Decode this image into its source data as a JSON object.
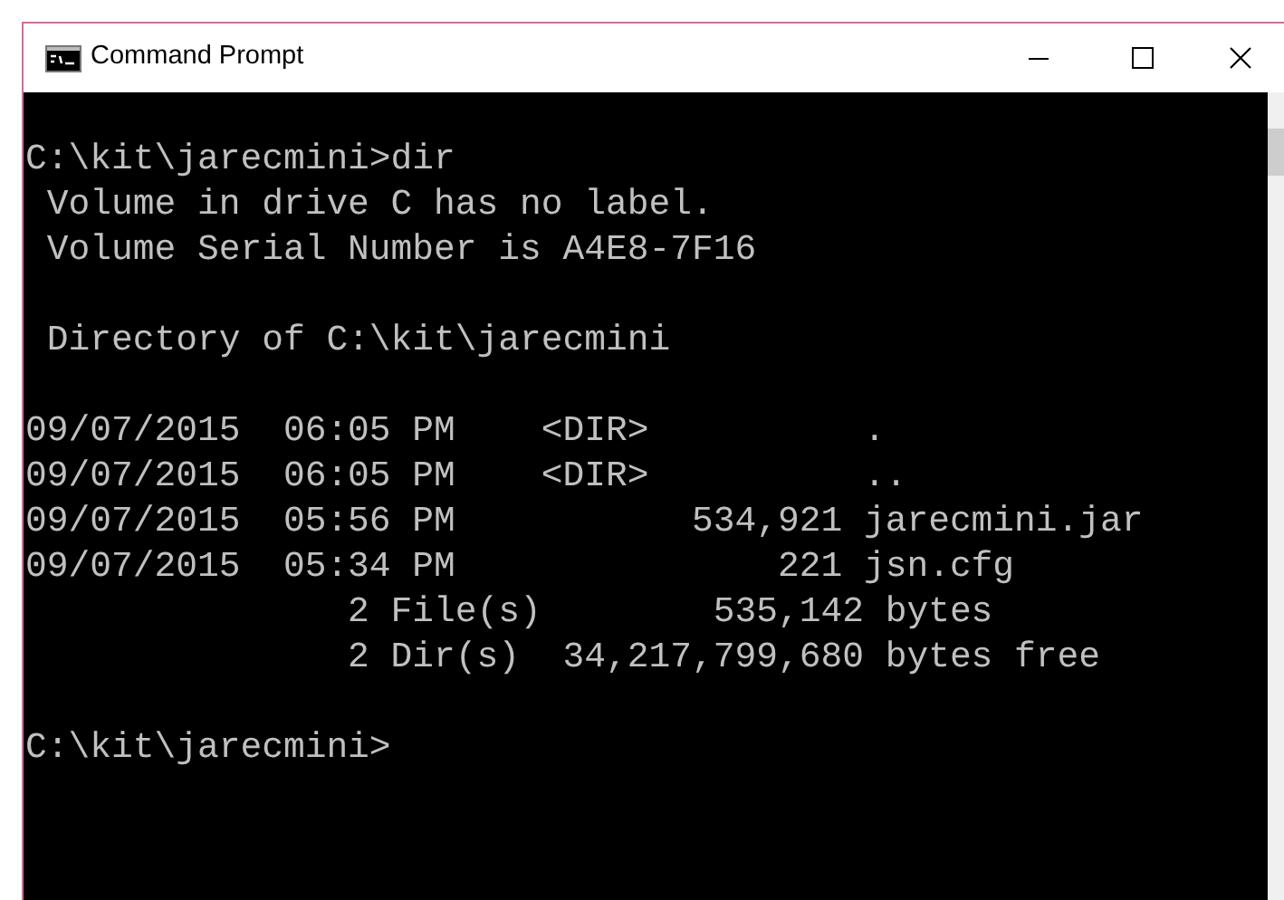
{
  "window": {
    "title": "Command Prompt"
  },
  "console": {
    "blocks": [
      {
        "lines": [
          "C:\\kit\\jarecmini>dir",
          " Volume in drive C has no label.",
          " Volume Serial Number is A4E8-7F16"
        ]
      },
      {
        "lines": [
          " Directory of C:\\kit\\jarecmini"
        ]
      },
      {
        "lines": [
          "09/07/2015  06:05 PM    <DIR>          .",
          "09/07/2015  06:05 PM    <DIR>          ..",
          "09/07/2015  05:56 PM           534,921 jarecmini.jar",
          "09/07/2015  05:34 PM               221 jsn.cfg",
          "               2 File(s)        535,142 bytes",
          "               2 Dir(s)  34,217,799,680 bytes free"
        ]
      },
      {
        "lines": [
          "C:\\kit\\jarecmini>"
        ]
      }
    ]
  }
}
